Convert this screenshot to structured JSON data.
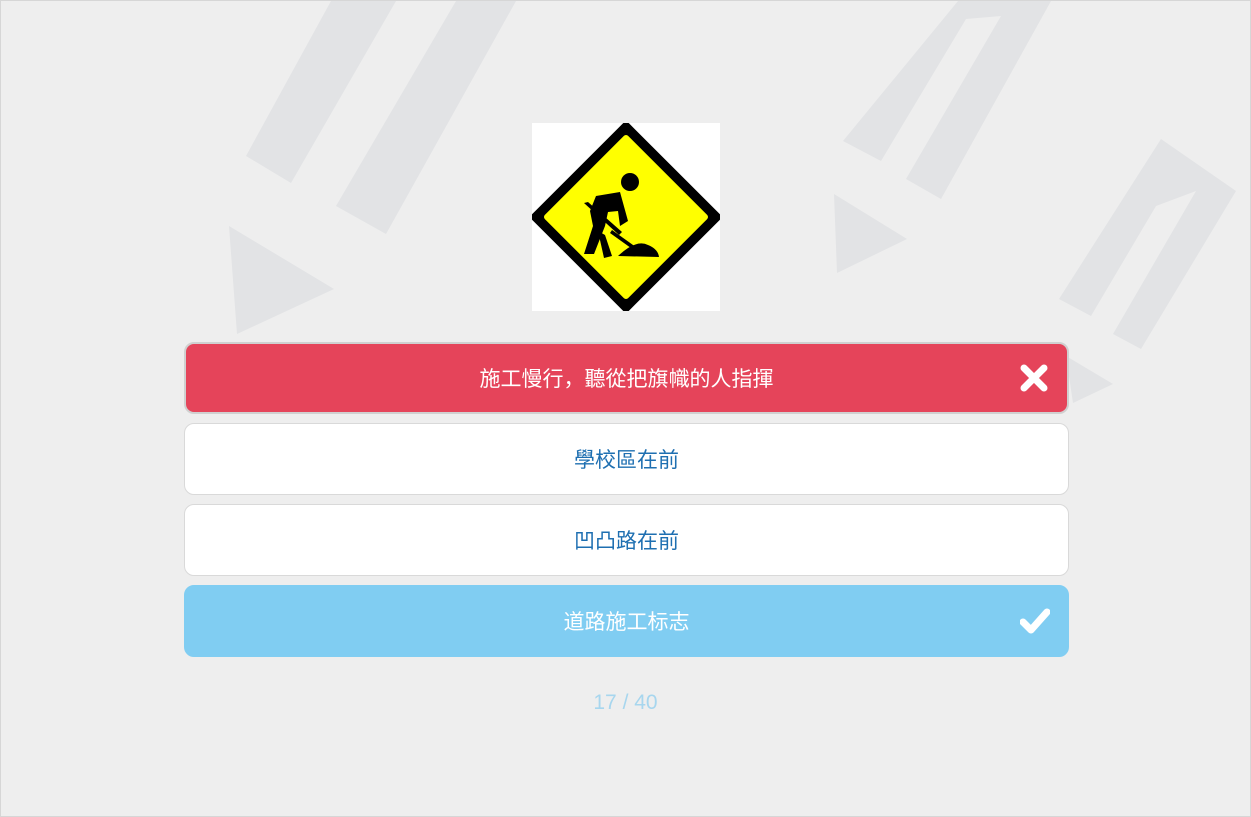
{
  "question": {
    "image": "road-work-sign-icon",
    "image_colors": {
      "fill": "#ffff00",
      "outline": "#000000"
    }
  },
  "answers": [
    {
      "label": "施工慢行，聽從把旗幟的人指揮",
      "state": "wrong",
      "status_icon": "close-icon"
    },
    {
      "label": "學校區在前",
      "state": "neutral"
    },
    {
      "label": "凹凸路在前",
      "state": "neutral"
    },
    {
      "label": "道路施工标志",
      "state": "correct",
      "status_icon": "check-icon"
    }
  ],
  "progress": {
    "text": "17 / 40",
    "current": 17,
    "total": 40
  },
  "colors": {
    "wrong": "#e5445a",
    "correct": "#80cdf2",
    "answer_text": "#1e6fb1",
    "background": "#eeeeee"
  }
}
